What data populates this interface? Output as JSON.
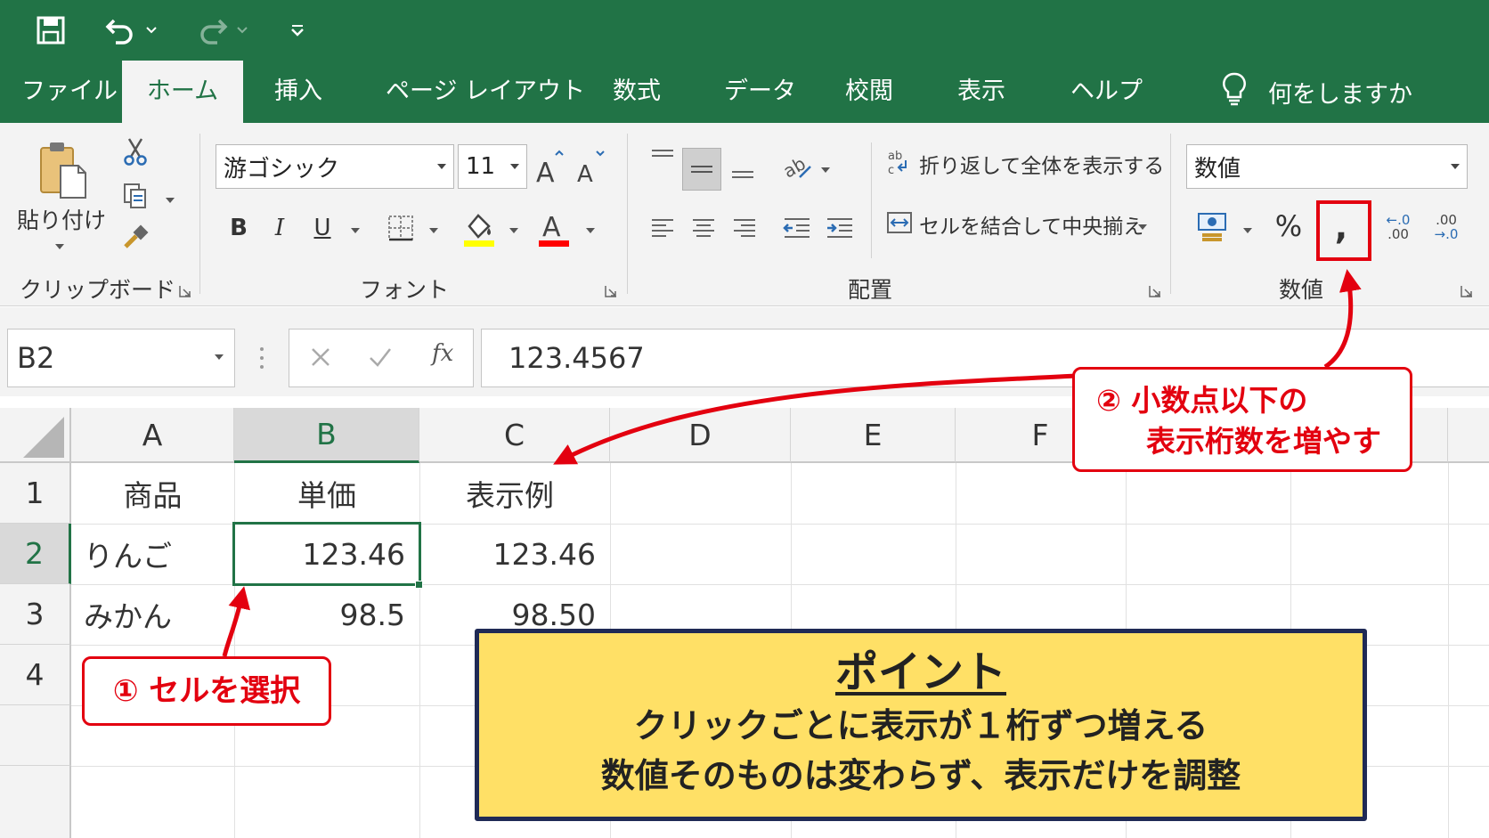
{
  "ribbon_tabs": [
    "ファイル",
    "ホーム",
    "挿入",
    "ページ レイアウト",
    "数式",
    "データ",
    "校閲",
    "表示",
    "ヘルプ"
  ],
  "tell_me": "何をしますか",
  "clipboard": {
    "paste_label": "貼り付け",
    "group_label": "クリップボード"
  },
  "font": {
    "name": "游ゴシック",
    "size": "11",
    "group_label": "フォント"
  },
  "alignment": {
    "wrap_text": "折り返して全体を表示する",
    "merge_center": "セルを結合して中央揃え",
    "group_label": "配置"
  },
  "number": {
    "format": "数値",
    "percent": "%",
    "comma": ",",
    "inc_decimal_top": "←.0",
    "inc_decimal_bottom": ".00",
    "dec_decimal_top": ".00",
    "dec_decimal_bottom": "→.0",
    "group_label": "数値"
  },
  "formula_bar": {
    "name_box": "B2",
    "fx": "fx",
    "formula": "123.4567"
  },
  "grid": {
    "columns": [
      "A",
      "B",
      "C",
      "D",
      "E",
      "F"
    ],
    "rows": [
      "1",
      "2",
      "3",
      "4"
    ],
    "cells": {
      "A1": "商品",
      "B1": "単価",
      "C1": "表示例",
      "A2": "りんご",
      "B2": "123.46",
      "C2": "123.46",
      "A3": "みかん",
      "B3": "98.5",
      "C3": "98.50"
    }
  },
  "callouts": {
    "step1": "① セルを選択",
    "step2_line1": "② 小数点以下の",
    "step2_line2": "表示桁数を増やす"
  },
  "point_box": {
    "title": "ポイント",
    "line1": "クリックごとに表示が１桁ずつ増える",
    "line2": "数値そのものは変わらず、表示だけを調整"
  },
  "colors": {
    "excel_green": "#217346",
    "accent_red": "#e3000f",
    "point_yellow": "#ffe066",
    "point_border": "#1f2a55"
  }
}
